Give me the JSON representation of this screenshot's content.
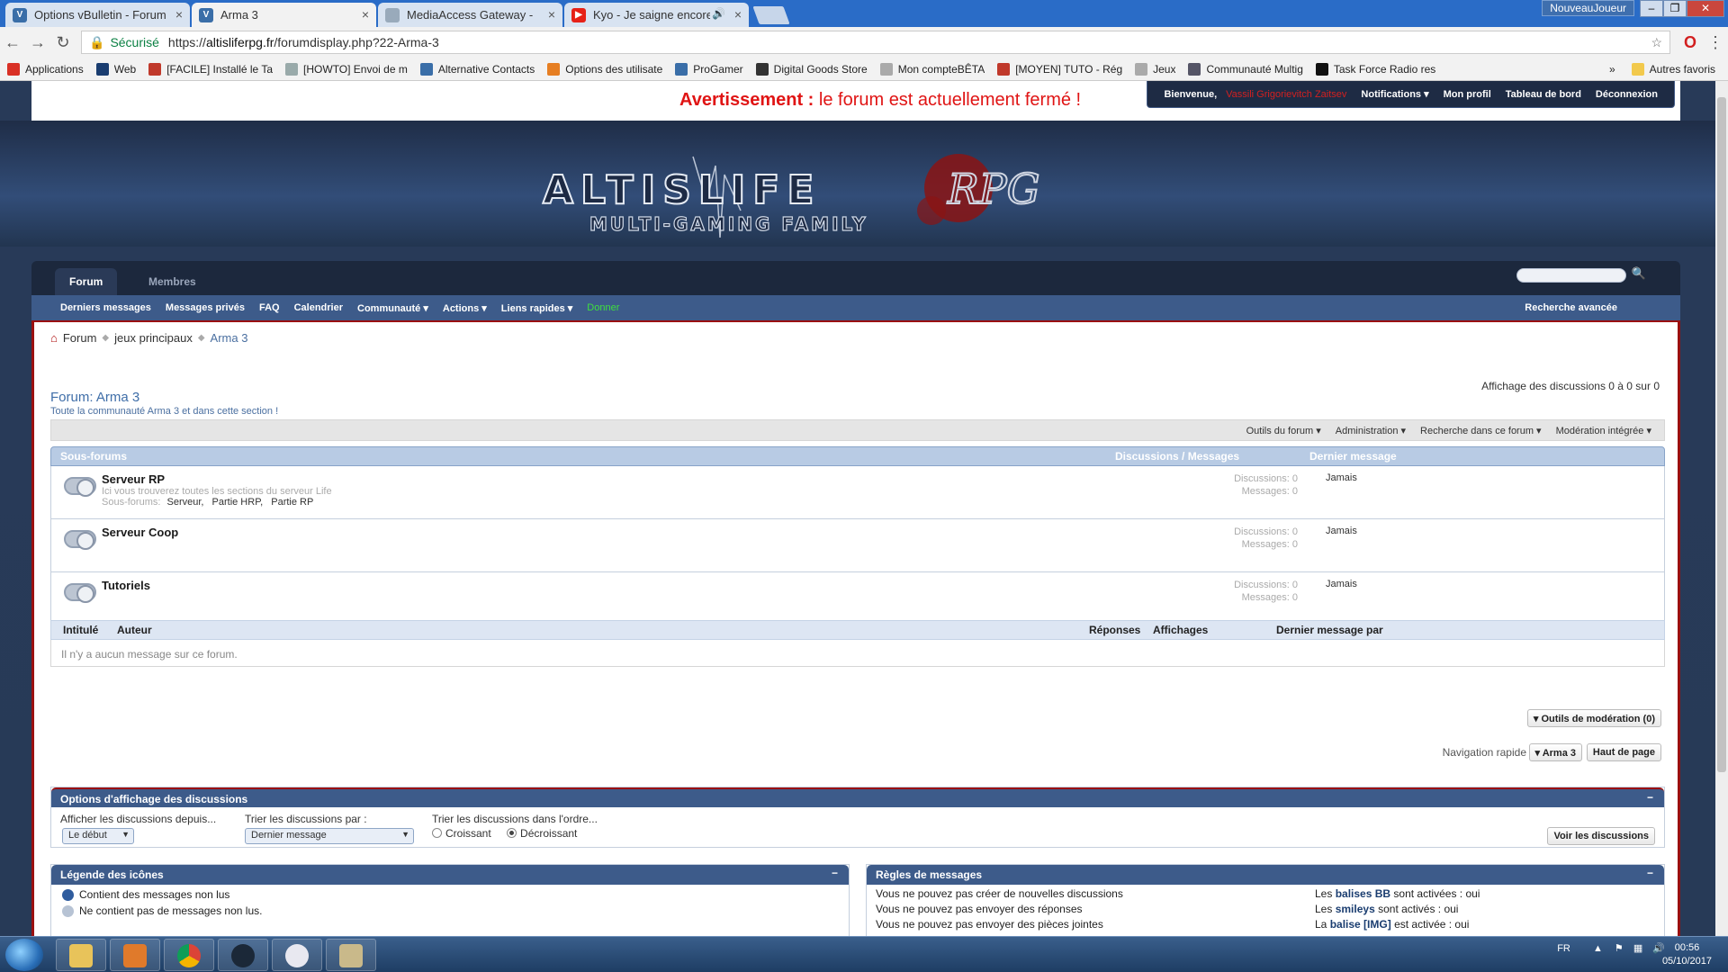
{
  "browser": {
    "tabs": [
      {
        "label": "Options vBulletin - Forum",
        "icon": "vbulletin-icon",
        "color": "#3a6ea8"
      },
      {
        "label": "Arma 3",
        "icon": "vbulletin-icon",
        "color": "#3a6ea8",
        "active": true
      },
      {
        "label": "MediaAccess Gateway -  ",
        "icon": "page-icon",
        "color": "#9ab"
      },
      {
        "label": "Kyo - Je saigne encore",
        "icon": "youtube-icon",
        "color": "#e62117"
      }
    ],
    "window_user": "NouveauJoueur",
    "secure_label": "Sécurisé",
    "url_prefix": "https://",
    "url_host": "altisliferpg.fr",
    "url_path": "/forumdisplay.php?22-Arma-3",
    "bookmarks": [
      {
        "label": "Applications",
        "color": "#d93025"
      },
      {
        "label": "Web",
        "color": "#1a3d70"
      },
      {
        "label": "[FACILE] Installé le Ta",
        "color": "#c0392b"
      },
      {
        "label": "[HOWTO] Envoi de m",
        "color": "#9aa"
      },
      {
        "label": "Alternative Contacts",
        "color": "#3a6ea8"
      },
      {
        "label": "Options des utilisate",
        "color": "#e67e22"
      },
      {
        "label": "ProGamer",
        "color": "#3a6ea8"
      },
      {
        "label": "Digital Goods Store",
        "color": "#333"
      },
      {
        "label": "Mon compteBÊTA",
        "color": "#aaa"
      },
      {
        "label": "[MOYEN] TUTO - Rég",
        "color": "#c0392b"
      },
      {
        "label": "Jeux",
        "color": "#aaa"
      },
      {
        "label": "Communauté Multig",
        "color": "#556"
      },
      {
        "label": "Task Force Radio res",
        "color": "#111"
      }
    ],
    "other_bookmarks": "Autres favoris"
  },
  "site": {
    "notice_bold": "Avertissement :",
    "notice_text": " le forum est actuellement fermé !",
    "welcome": "Bienvenue,",
    "username": "Vassili Grigorievitch Zaitsev",
    "user_links": [
      "Notifications ▾",
      "Mon profil",
      "Tableau de bord",
      "Déconnexion"
    ],
    "logo_main": "ALTISLIFE",
    "logo_rpg": "RPG",
    "logo_sub": "MULTI-GAMING FAMILY",
    "nav_tabs": [
      "Forum",
      "Membres"
    ],
    "subnav": [
      "Derniers messages",
      "Messages privés",
      "FAQ",
      "Calendrier",
      "Communauté ▾",
      "Actions ▾",
      "Liens rapides ▾"
    ],
    "donate": "Donner",
    "advanced_search": "Recherche avancée"
  },
  "breadcrumb": [
    "Forum",
    "jeux principaux",
    "Arma 3"
  ],
  "forum": {
    "title": "Forum: Arma 3",
    "description": "Toute la communauté Arma 3 et dans cette section !",
    "count": "Affichage des discussions 0 à 0 sur 0",
    "tools": [
      "Outils du forum ▾",
      "Administration ▾",
      "Recherche dans ce forum ▾",
      "Modération intégrée ▾"
    ]
  },
  "subforums": {
    "head_title": "Sous-forums",
    "head_stats": "Discussions / Messages",
    "head_last": "Dernier message",
    "sub_label": "Sous-forums:",
    "rows": [
      {
        "name": "Serveur RP",
        "desc": "Ici vous trouverez toutes les sections du serveur Life",
        "subs": [
          "Serveur,",
          "Partie HRP,",
          "Partie RP"
        ],
        "threads": "Discussions: 0",
        "posts": "Messages: 0",
        "last": "Jamais"
      },
      {
        "name": "Serveur Coop",
        "desc": "",
        "subs": [],
        "threads": "Discussions: 0",
        "posts": "Messages: 0",
        "last": "Jamais"
      },
      {
        "name": "Tutoriels",
        "desc": "",
        "subs": [],
        "threads": "Discussions: 0",
        "posts": "Messages: 0",
        "last": "Jamais"
      }
    ]
  },
  "threads": {
    "col_title": "Intitulé",
    "col_author": "Auteur",
    "col_replies": "Réponses",
    "col_views": "Affichages",
    "col_last": "Dernier message par",
    "empty": "Il n'y a aucun message sur ce forum."
  },
  "moderation_tools": "▾ Outils de modération (0)",
  "quick_nav_label": "Navigation rapide",
  "quick_nav_select": "▾ Arma 3",
  "top_of_page": "Haut de page",
  "options": {
    "title": "Options d'affichage des discussions",
    "since_label": "Afficher les discussions depuis...",
    "since_value": "Le début",
    "sort_label": "Trier les discussions par :",
    "sort_value": "Dernier message",
    "order_label": "Trier les discussions dans l'ordre...",
    "asc": "Croissant",
    "desc": "Décroissant",
    "submit": "Voir les discussions"
  },
  "legend": {
    "title": "Légende des icônes",
    "items": [
      "Contient des messages non lus",
      "Ne contient pas de messages non lus."
    ]
  },
  "rules": {
    "title": "Règles de messages",
    "left": [
      "Vous ne pouvez pas créer de nouvelles discussions",
      "Vous ne pouvez pas envoyer des réponses",
      "Vous ne pouvez pas envoyer des pièces jointes"
    ],
    "right_pre": [
      "Les",
      "Les",
      "La"
    ],
    "right_bold": [
      "balises BB",
      "smileys",
      "balise [IMG]"
    ],
    "right_post": [
      "sont activées : oui",
      "sont activés : oui",
      "est activée : oui"
    ]
  },
  "taskbar": {
    "lang": "FR",
    "time": "00:56",
    "date": "05/10/2017"
  },
  "colors": {
    "accent_red": "#9a1010",
    "nav_blue": "#3d5b8a",
    "donate_green": "#3ee03e"
  }
}
